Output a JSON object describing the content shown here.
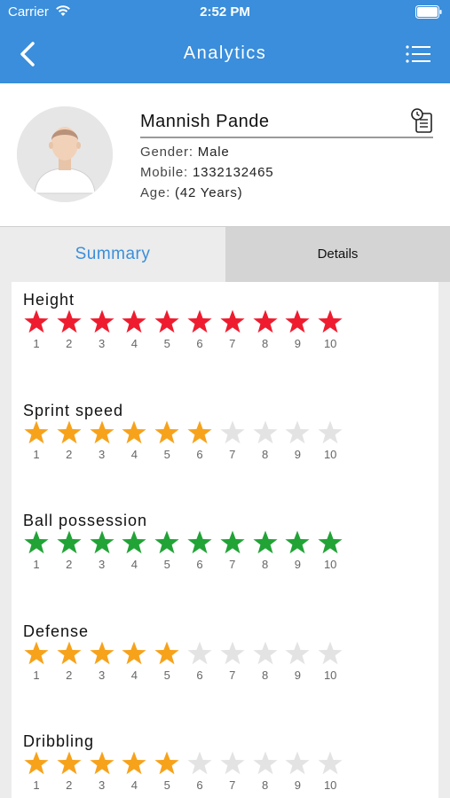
{
  "status_bar": {
    "carrier": "Carrier",
    "time": "2:52 PM"
  },
  "nav": {
    "title": "Analytics",
    "back_icon": "chevron-left-icon",
    "menu_icon": "list-menu-icon"
  },
  "profile": {
    "name": "Mannish Pande",
    "gender_label": "Gender:",
    "gender": "Male",
    "mobile_label": "Mobile:",
    "mobile": "1332132465",
    "age_label": "Age:",
    "age": "(42 Years)"
  },
  "tabs": {
    "summary": "Summary",
    "details": "Details",
    "active": "summary"
  },
  "colors": {
    "brand": "#3a8edb",
    "star_red": "#ee1c2e",
    "star_orange": "#f7a21b",
    "star_green": "#21a336",
    "star_empty": "#e3e3e3"
  },
  "skills": [
    {
      "label": "Height",
      "rating": 10,
      "max": 10,
      "color": "#ee1c2e",
      "ticks": [
        "1",
        "2",
        "3",
        "4",
        "5",
        "6",
        "7",
        "8",
        "9",
        "10"
      ]
    },
    {
      "label": "Sprint speed",
      "rating": 6,
      "max": 10,
      "color": "#f7a21b",
      "ticks": [
        "1",
        "2",
        "3",
        "4",
        "5",
        "6",
        "7",
        "8",
        "9",
        "10"
      ]
    },
    {
      "label": "Ball possession",
      "rating": 10,
      "max": 10,
      "color": "#21a336",
      "ticks": [
        "1",
        "2",
        "3",
        "4",
        "5",
        "6",
        "7",
        "8",
        "9",
        "10"
      ]
    },
    {
      "label": "Defense",
      "rating": 5,
      "max": 10,
      "color": "#f7a21b",
      "ticks": [
        "1",
        "2",
        "3",
        "4",
        "5",
        "6",
        "7",
        "8",
        "9",
        "10"
      ]
    },
    {
      "label": "Dribbling",
      "rating": 5,
      "max": 10,
      "color": "#f7a21b",
      "ticks": [
        "1",
        "2",
        "3",
        "4",
        "5",
        "6",
        "7",
        "8",
        "9",
        "10"
      ]
    }
  ]
}
